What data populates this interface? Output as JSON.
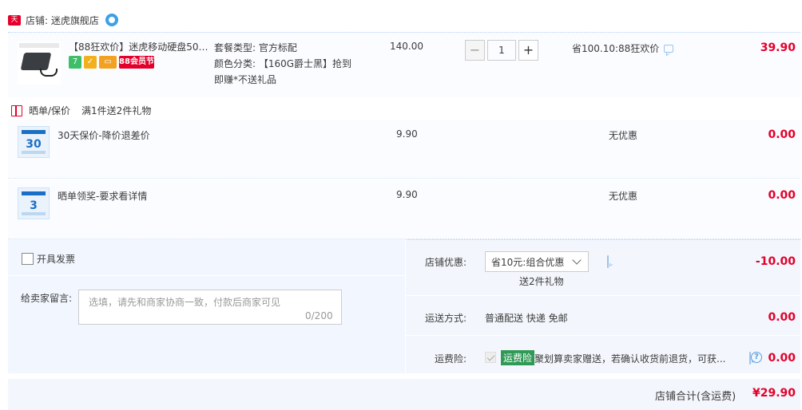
{
  "store": {
    "badge": "天猫",
    "name": "店铺: 迷虎旗舰店"
  },
  "product": {
    "title": "【88狂欢价】迷虎移动硬盘500...",
    "badges": [
      "7",
      "",
      "",
      "88会员节"
    ],
    "sku_type": "套餐类型: 官方标配",
    "sku_color": "颜色分类: 【160G爵士黑】抢到",
    "sku_color_2": "即赚*不送礼品",
    "unit_price": "140.00",
    "qty_minus": "−",
    "quantity": "1",
    "qty_plus": "+",
    "promo": "省100.10:88狂欢价",
    "subtotal": "39.90"
  },
  "services_header": {
    "label": "晒单/保价",
    "gift": "满1件送2件礼物"
  },
  "services": [
    {
      "icon_num": "30",
      "name": "30天保价-降价退差价",
      "price": "9.90",
      "promo": "无优惠",
      "total": "0.00"
    },
    {
      "icon_num": "3",
      "name": "晒单领奖-要求看详情",
      "price": "9.90",
      "promo": "无优惠",
      "total": "0.00"
    }
  ],
  "invoice": {
    "label": "开具发票"
  },
  "message": {
    "label": "给卖家留言:",
    "placeholder": "选填，请先和商家协商一致，付款后商家可见",
    "count": "0/200"
  },
  "shop_discount": {
    "label": "店铺优惠:",
    "selected": "省10元:组合优惠",
    "gift": "送2件礼物",
    "amount": "-10.00"
  },
  "shipping": {
    "label": "运送方式:",
    "value": "普通配送 快递 免邮",
    "amount": "0.00"
  },
  "insurance": {
    "label": "运费险:",
    "tag": "运费险",
    "text": "聚划算卖家赠送，若确认收货前退货，可获...",
    "help": "?",
    "amount": "0.00"
  },
  "total": {
    "label": "店铺合计(含运费)",
    "amount": "¥29.90"
  },
  "colors": {
    "accent_red": "#e4002b",
    "insurance_green": "#2f9a55",
    "panel_bg": "#f3f6fc"
  }
}
